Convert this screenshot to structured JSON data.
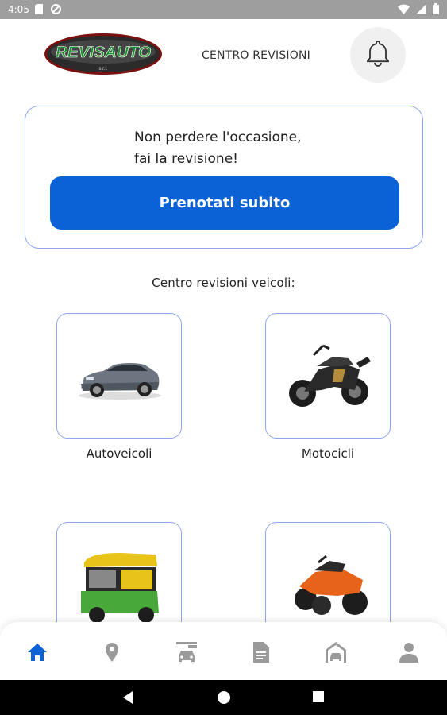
{
  "status_bar": {
    "time": "4:05"
  },
  "header": {
    "title": "CENTRO REVISIONI",
    "logo_text": "REVISAUTO",
    "logo_sub": "s.r.l."
  },
  "promo": {
    "line1": "Non perdere l'occasione,",
    "line2": "fai la revisione!",
    "button_label": "Prenotati subito"
  },
  "section_title": "Centro revisioni veicoli:",
  "vehicles": [
    {
      "label": "Autoveicoli",
      "icon": "car-image"
    },
    {
      "label": "Motocicli",
      "icon": "motorcycle-image"
    },
    {
      "label": "",
      "icon": "tuk-tuk-image"
    },
    {
      "label": "",
      "icon": "quad-image"
    }
  ],
  "bottom_nav": [
    {
      "name": "home",
      "icon": "home-icon",
      "active": true
    },
    {
      "name": "location",
      "icon": "location-pin-icon",
      "active": false
    },
    {
      "name": "garage",
      "icon": "garage-icon",
      "active": false
    },
    {
      "name": "documents",
      "icon": "document-icon",
      "active": false
    },
    {
      "name": "car-service",
      "icon": "car-house-icon",
      "active": false
    },
    {
      "name": "profile",
      "icon": "person-icon",
      "active": false
    }
  ],
  "colors": {
    "primary": "#0a62d6",
    "border": "#8fa7f2",
    "nav_inactive": "#9a9a9a"
  }
}
